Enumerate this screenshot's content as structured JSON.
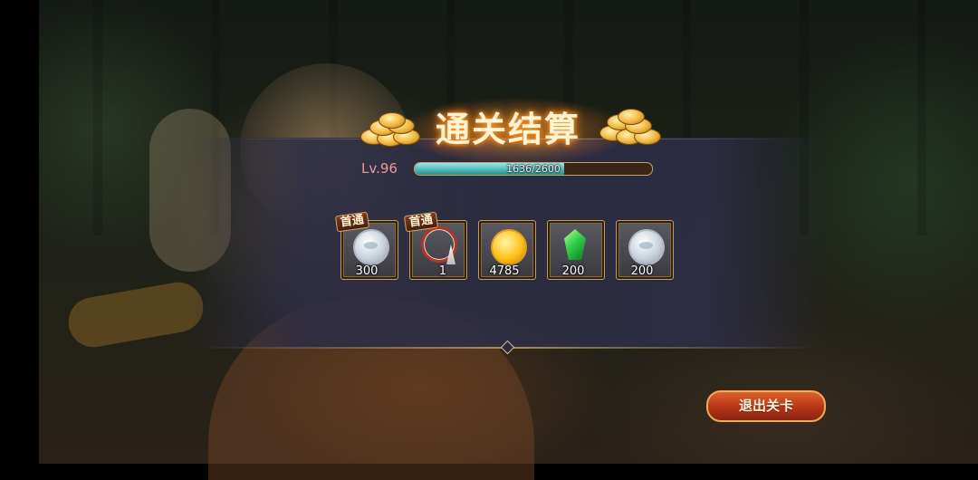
{
  "result": {
    "title": "通关结算",
    "level_label": "Lv.96",
    "xp": {
      "current": 1636,
      "max": 2600,
      "text": "1636/2600",
      "fraction": 0.629
    }
  },
  "rewards": [
    {
      "icon": "silver-coin-icon",
      "badge": "首通",
      "quantity": "300"
    },
    {
      "icon": "bracelet-icon",
      "badge": "首通",
      "quantity": "1"
    },
    {
      "icon": "gold-coin-icon",
      "badge": "",
      "quantity": "4785"
    },
    {
      "icon": "green-crystal-icon",
      "badge": "",
      "quantity": "200"
    },
    {
      "icon": "silver-coin-icon",
      "badge": "",
      "quantity": "200"
    }
  ],
  "exit_button": {
    "label": "退出关卡"
  },
  "colors": {
    "title_glow": "#ff9a2a",
    "xp_fill": "#49b7b5",
    "level_text": "#e89a9a",
    "exit_button": "#b53418",
    "slot_border": "#c99a4a"
  }
}
